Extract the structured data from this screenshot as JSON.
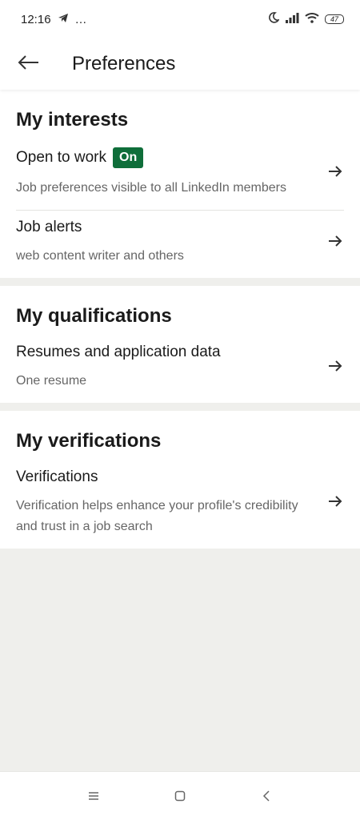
{
  "status_bar": {
    "time": "12:16",
    "extra": "…",
    "battery": "47"
  },
  "header": {
    "title": "Preferences"
  },
  "sections": [
    {
      "heading": "My interests",
      "items": [
        {
          "title": "Open to work",
          "badge": "On",
          "subtitle": "Job preferences visible to all LinkedIn members"
        },
        {
          "title": "Job alerts",
          "subtitle": "web content writer and others"
        }
      ]
    },
    {
      "heading": "My qualifications",
      "items": [
        {
          "title": "Resumes and application data",
          "subtitle": "One resume"
        }
      ]
    },
    {
      "heading": "My verifications",
      "items": [
        {
          "title": "Verifications",
          "subtitle": "Verification helps enhance your profile's credibility and trust in a job search"
        }
      ]
    }
  ],
  "colors": {
    "badge_green": "#0f6e3a",
    "page_background": "#efefec"
  },
  "icons": {
    "status": [
      "telegram-icon",
      "moon-icon",
      "signal-icon",
      "wifi-icon",
      "battery-icon"
    ],
    "header": "back-arrow-icon",
    "row": "arrow-right-icon",
    "nav": [
      "menu-icon",
      "home-square-icon",
      "back-chevron-icon"
    ]
  }
}
